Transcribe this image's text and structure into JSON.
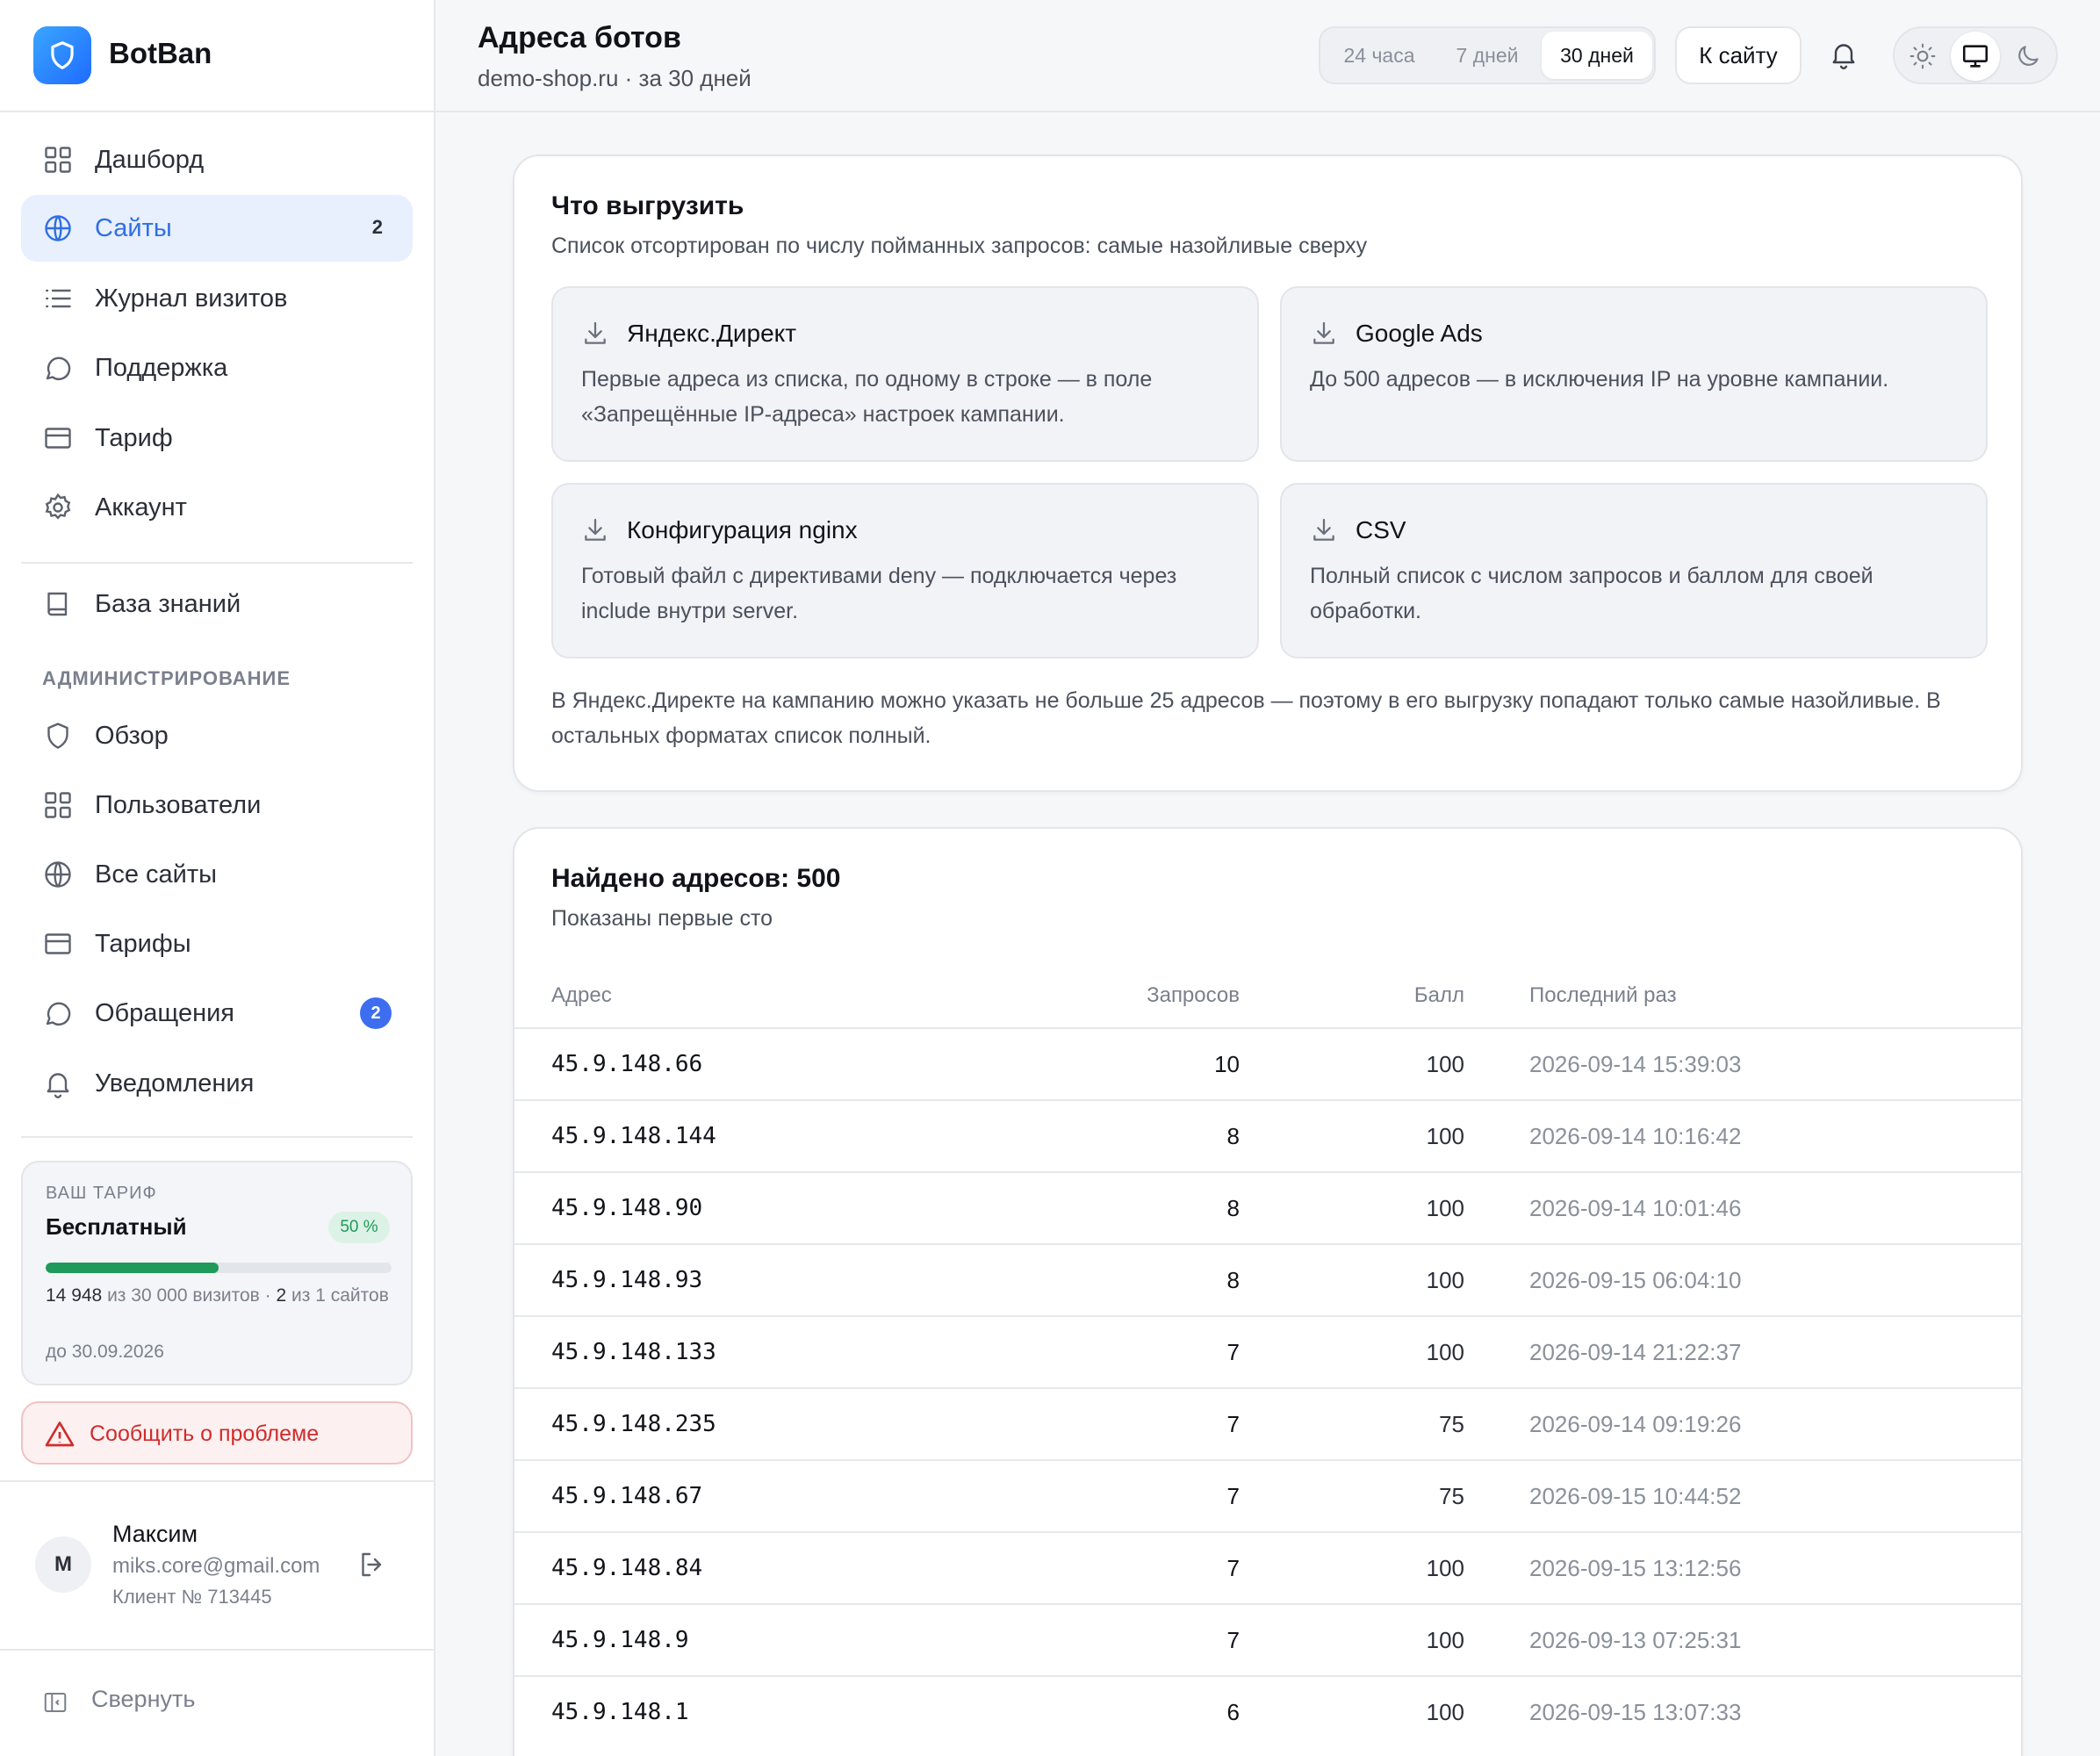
{
  "brand": {
    "name": "BotBan",
    "logo_icon": "shield-icon",
    "accent": "#2f80ff"
  },
  "sidebar": {
    "items": [
      {
        "label": "Дашборд",
        "icon": "grid-icon"
      },
      {
        "label": "Сайты",
        "icon": "globe-icon",
        "count": "2",
        "active": true
      },
      {
        "label": "Журнал визитов",
        "icon": "list-icon"
      },
      {
        "label": "Поддержка",
        "icon": "chat-icon"
      },
      {
        "label": "Тариф",
        "icon": "card-icon"
      },
      {
        "label": "Аккаунт",
        "icon": "gear-icon"
      }
    ],
    "knowledge": {
      "label": "База знаний",
      "icon": "book-icon"
    },
    "admin_title": "АДМИНИСТРИРОВАНИЕ",
    "admin_items": [
      {
        "label": "Обзор",
        "icon": "shield-icon"
      },
      {
        "label": "Пользователи",
        "icon": "grid-icon"
      },
      {
        "label": "Все сайты",
        "icon": "globe-icon"
      },
      {
        "label": "Тарифы",
        "icon": "card-icon"
      },
      {
        "label": "Обращения",
        "icon": "chat-icon",
        "badge": "2"
      },
      {
        "label": "Уведомления",
        "icon": "bell-icon"
      }
    ],
    "plan": {
      "kicker": "ВАШ ТАРИФ",
      "name": "Бесплатный",
      "percent_label": "50 %",
      "progress": 0.5,
      "visits_used": "14 948",
      "visits_mid": "из 30 000 визитов ·",
      "sites_used": "2",
      "sites_tail": "из 1 сайтов",
      "until": "до 30.09.2026"
    },
    "report_label": "Сообщить о проблеме",
    "user": {
      "initial": "M",
      "name": "Максим",
      "email": "miks.core@gmail.com",
      "client_id": "Клиент № 713445"
    },
    "collapse_label": "Свернуть"
  },
  "header": {
    "title": "Адреса ботов",
    "subtitle": "demo-shop.ru · за 30 дней",
    "ranges": [
      "24 часа",
      "7 дней",
      "30 дней"
    ],
    "active_range": "30 дней",
    "site_button": "К сайту",
    "theme_modes": [
      "sun-icon",
      "monitor-icon",
      "moon-icon"
    ],
    "active_theme": "monitor-icon"
  },
  "export": {
    "title": "Что выгрузить",
    "subtitle": "Список отсортирован по числу пойманных запросов: самые назойливые сверху",
    "options": [
      {
        "title": "Яндекс.Директ",
        "desc": "Первые адреса из списка, по одному в строке — в поле «Запрещённые IP-адреса» настроек кампании."
      },
      {
        "title": "Google Ads",
        "desc": "До 500 адресов — в исключения IP на уровне кампании."
      },
      {
        "title": "Конфигурация nginx",
        "desc": "Готовый файл с директивами deny — подключается через include внутри server."
      },
      {
        "title": "CSV",
        "desc": "Полный список с числом запросов и баллом для своей обработки."
      }
    ],
    "note": "В Яндекс.Директе на кампанию можно указать не больше 25 адресов — поэтому в его выгрузку попадают только самые назойливые. В остальных форматах список полный."
  },
  "table": {
    "title": "Найдено адресов: 500",
    "subtitle": "Показаны первые сто",
    "columns": [
      "Адрес",
      "Запросов",
      "Балл",
      "Последний раз"
    ],
    "rows": [
      {
        "ip": "45.9.148.66",
        "requests": "10",
        "score": "100",
        "last": "2026-09-14 15:39:03"
      },
      {
        "ip": "45.9.148.144",
        "requests": "8",
        "score": "100",
        "last": "2026-09-14 10:16:42"
      },
      {
        "ip": "45.9.148.90",
        "requests": "8",
        "score": "100",
        "last": "2026-09-14 10:01:46"
      },
      {
        "ip": "45.9.148.93",
        "requests": "8",
        "score": "100",
        "last": "2026-09-15 06:04:10"
      },
      {
        "ip": "45.9.148.133",
        "requests": "7",
        "score": "100",
        "last": "2026-09-14 21:22:37"
      },
      {
        "ip": "45.9.148.235",
        "requests": "7",
        "score": "75",
        "last": "2026-09-14 09:19:26"
      },
      {
        "ip": "45.9.148.67",
        "requests": "7",
        "score": "75",
        "last": "2026-09-15 10:44:52"
      },
      {
        "ip": "45.9.148.84",
        "requests": "7",
        "score": "100",
        "last": "2026-09-15 13:12:56"
      },
      {
        "ip": "45.9.148.9",
        "requests": "7",
        "score": "100",
        "last": "2026-09-13 07:25:31"
      },
      {
        "ip": "45.9.148.1",
        "requests": "6",
        "score": "100",
        "last": "2026-09-15 13:07:33"
      }
    ]
  }
}
